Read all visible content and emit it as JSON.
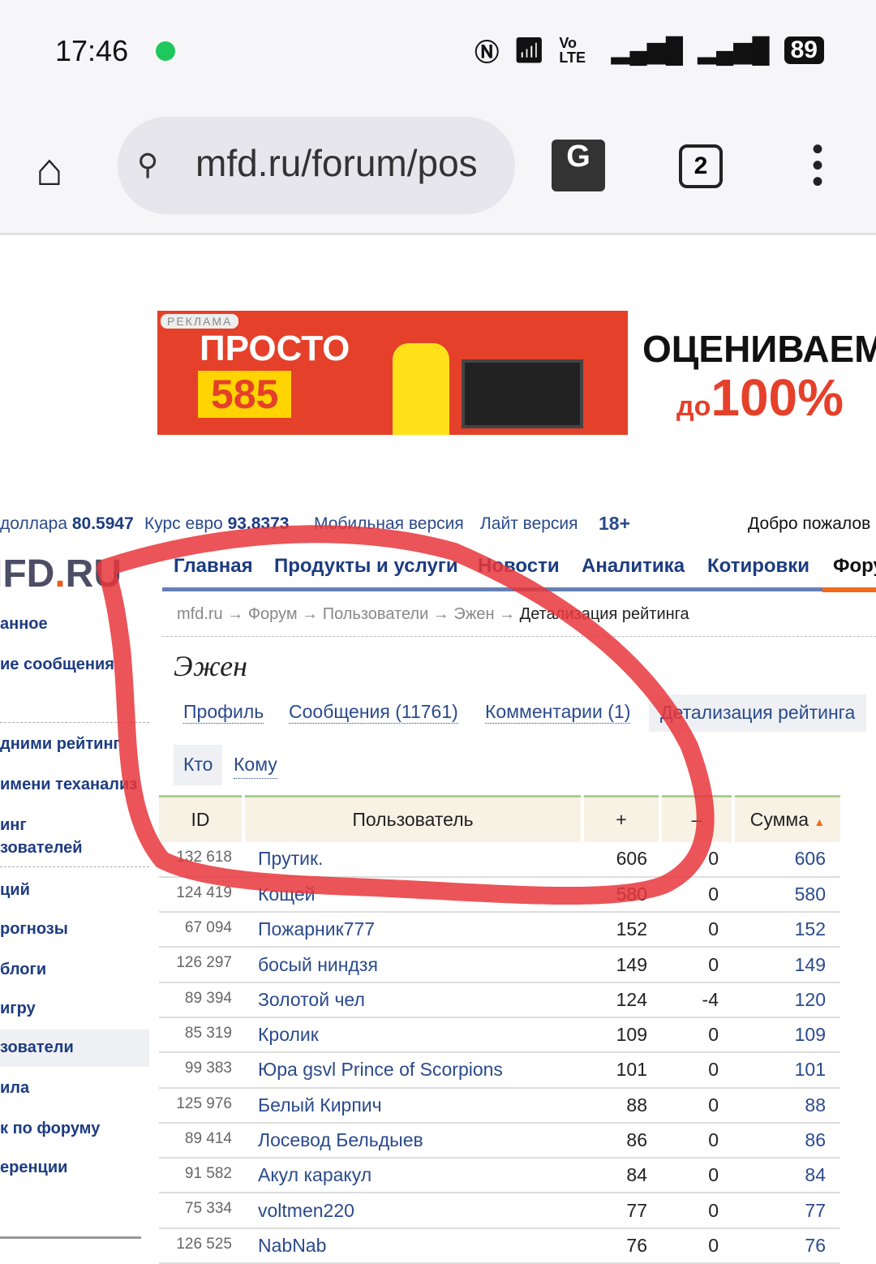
{
  "status_bar": {
    "time": "17:46",
    "icons": [
      "nfc-icon",
      "wifi-icon",
      "volte-icon",
      "signal-icon",
      "signal-icon"
    ],
    "volte": "Vo LTE",
    "battery": "89"
  },
  "browser": {
    "url": "mfd.ru/forum/pos",
    "tab_count": "2"
  },
  "banner": {
    "ad_label": "РЕКЛАМА",
    "left_line1": "ПРОСТО",
    "left_line2": "585",
    "right_line1": "ОЦЕНИВАЕМ",
    "right_prefix": "до",
    "right_value": "100%"
  },
  "topline": {
    "dollar_label": "доллара",
    "dollar_value": "80.5947",
    "euro_label": "Курс евро",
    "euro_value": "93.8373",
    "mobile": "Мобильная версия",
    "lite": "Лайт версия",
    "age": "18+",
    "welcome": "Добро пожалов"
  },
  "logo": {
    "a": "IFD",
    "b": ".",
    "c": "RU"
  },
  "nav": [
    "Главная",
    "Продукты и услуги",
    "Новости",
    "Аналитика",
    "Котировки",
    "Фору"
  ],
  "breadcrumb": [
    "mfd.ru",
    "Форум",
    "Пользователи",
    "Эжен",
    "Детализация рейтинга"
  ],
  "user": {
    "name": "Эжен"
  },
  "profile_tabs": [
    "Профиль",
    "Сообщения (11761)",
    "Комментарии (1)",
    "Детализация рейтинга"
  ],
  "direction_tabs": [
    "Кто",
    "Кому"
  ],
  "sidebar": [
    "анное",
    "ие сообщения",
    "дними рейтинг",
    "имени теханализ",
    "инг",
    "зователей",
    "ций",
    "рогнозы",
    "блоги",
    "игру",
    "зователи",
    "ила",
    "к по форуму",
    "еренции"
  ],
  "table": {
    "headers": [
      "ID",
      "Пользователь",
      "+",
      "–",
      "Сумма"
    ],
    "rows": [
      {
        "id": "132 618",
        "name": "Прутик.",
        "plus": "606",
        "minus": "0",
        "sum": "606"
      },
      {
        "id": "124 419",
        "name": "Кощей",
        "plus": "580",
        "minus": "0",
        "sum": "580"
      },
      {
        "id": "67 094",
        "name": "Пожарник777",
        "plus": "152",
        "minus": "0",
        "sum": "152"
      },
      {
        "id": "126 297",
        "name": "босый ниндзя",
        "plus": "149",
        "minus": "0",
        "sum": "149"
      },
      {
        "id": "89 394",
        "name": "Золотой чел",
        "plus": "124",
        "minus": "-4",
        "sum": "120"
      },
      {
        "id": "85 319",
        "name": "Кролик",
        "plus": "109",
        "minus": "0",
        "sum": "109"
      },
      {
        "id": "99 383",
        "name": "Юра gsvl Prince of Scorpions",
        "plus": "101",
        "minus": "0",
        "sum": "101"
      },
      {
        "id": "125 976",
        "name": "Белый Кирпич",
        "plus": "88",
        "minus": "0",
        "sum": "88"
      },
      {
        "id": "89 414",
        "name": "Лосевод Бельдыев",
        "plus": "86",
        "minus": "0",
        "sum": "86"
      },
      {
        "id": "91 582",
        "name": "Акул каракул",
        "plus": "84",
        "minus": "0",
        "sum": "84"
      },
      {
        "id": "75 334",
        "name": "voltmen220",
        "plus": "77",
        "minus": "0",
        "sum": "77"
      },
      {
        "id": "126 525",
        "name": "NabNab",
        "plus": "76",
        "minus": "0",
        "sum": "76"
      }
    ]
  },
  "colors": {
    "link": "#2a4a8c",
    "accent": "#f26a1b",
    "annotation": "#e8363b"
  }
}
